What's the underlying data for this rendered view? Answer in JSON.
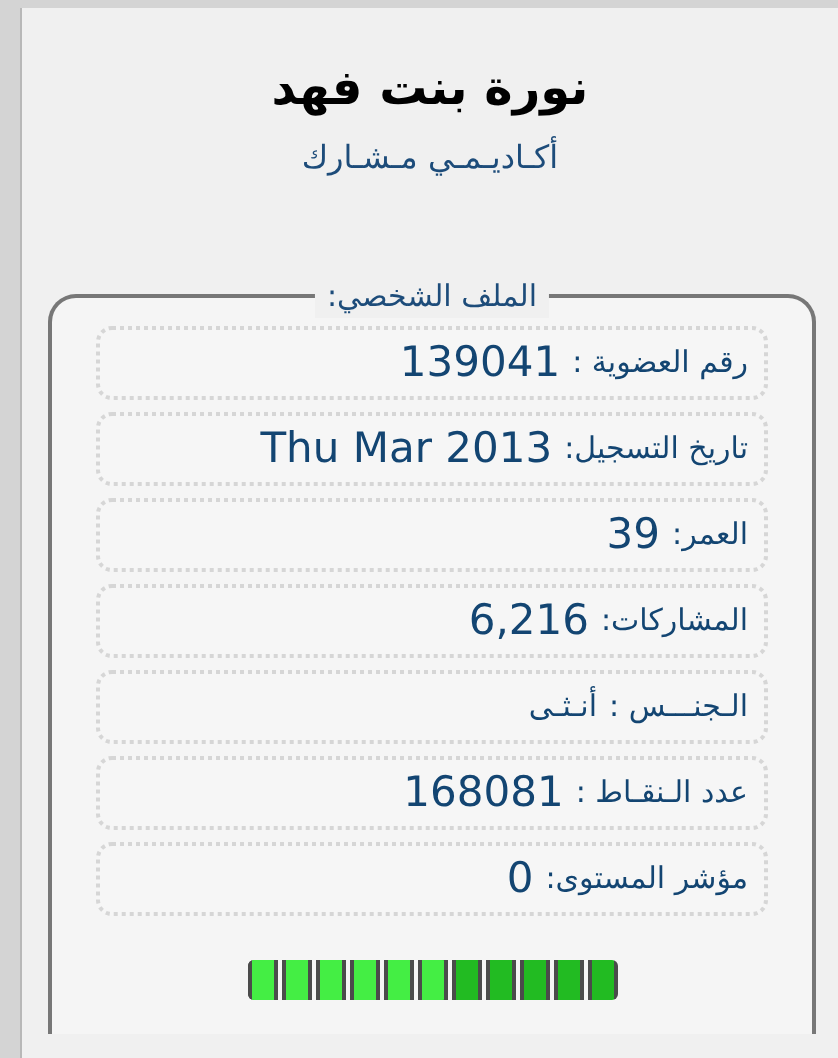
{
  "profile": {
    "name": "نورة بنت فهد",
    "rank": "أكـاديـمـي مـشـارك"
  },
  "fieldset": {
    "legend": "الملف الشخصي:",
    "rows": [
      {
        "kind": "number",
        "label": "رقم العضوية :",
        "value": "139041"
      },
      {
        "kind": "number",
        "label": "تاريخ التسجيل:",
        "value": "Thu Mar 2013"
      },
      {
        "kind": "number",
        "label": "العمر:",
        "value": "39"
      },
      {
        "kind": "number",
        "label": "المشاركات:",
        "value": "6,216"
      },
      {
        "kind": "text",
        "label": "الـجنـــس :",
        "value": "أنـثـى"
      },
      {
        "kind": "number",
        "label": "عدد الـنقـاط :",
        "value": "168081"
      },
      {
        "kind": "number",
        "label": "مؤشر المستوى:",
        "value": "0"
      }
    ],
    "meter": {
      "level": 0.545
    }
  }
}
